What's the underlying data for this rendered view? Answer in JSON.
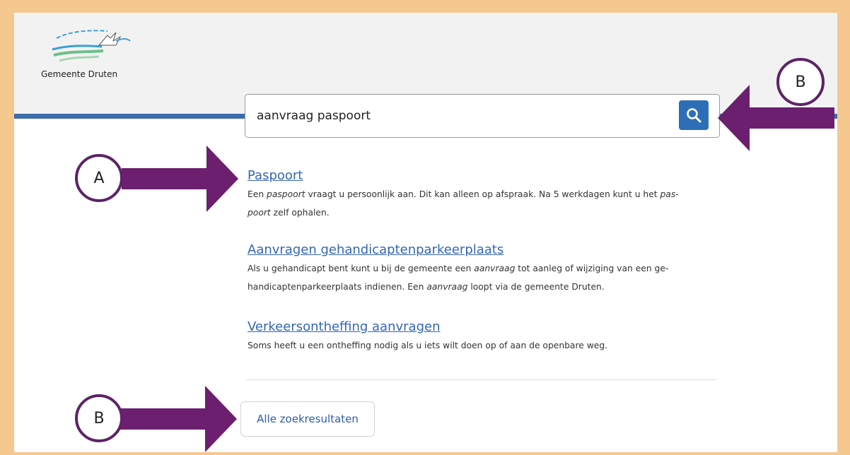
{
  "site": {
    "logo_text": "Gemeente Druten"
  },
  "search": {
    "query": "aanvraag paspoort",
    "button_icon": "search-icon"
  },
  "results": [
    {
      "title": "Paspoort",
      "desc_parts": [
        {
          "t": "Een "
        },
        {
          "t": "paspoort",
          "em": true
        },
        {
          "t": " vraagt u persoonlijk aan. Dit kan alleen op afspraak. Na 5 werkdagen kunt u het "
        },
        {
          "t": "pas-",
          "em": true
        },
        {
          "br": true
        },
        {
          "t": "poort",
          "em": true
        },
        {
          "t": " zelf ophalen."
        }
      ]
    },
    {
      "title": "Aanvragen gehandicaptenparkeerplaats",
      "desc_parts": [
        {
          "t": "Als u gehandicapt bent kunt u bij de gemeente een "
        },
        {
          "t": "aanvraag",
          "em": true
        },
        {
          "t": " tot aanleg of wijziging van een ge-"
        },
        {
          "br": true
        },
        {
          "t": "handicaptenparkeerplaats indienen. Een "
        },
        {
          "t": "aanvraag",
          "em": true
        },
        {
          "t": " loopt via de gemeente Druten."
        }
      ]
    },
    {
      "title": "Verkeersontheffing aanvragen",
      "desc_parts": [
        {
          "t": "Soms heeft u een ontheffing nodig als u iets wilt doen op of aan de openbare weg."
        }
      ]
    }
  ],
  "all_results_label": "Alle zoekresultaten",
  "annotations": {
    "label_a": "A",
    "label_b_top": "B",
    "label_b_bottom": "B",
    "color": "#6b1f6e"
  },
  "colors": {
    "frame": "#f5c890",
    "brand_blue": "#3d6cac",
    "link": "#3566b5"
  }
}
